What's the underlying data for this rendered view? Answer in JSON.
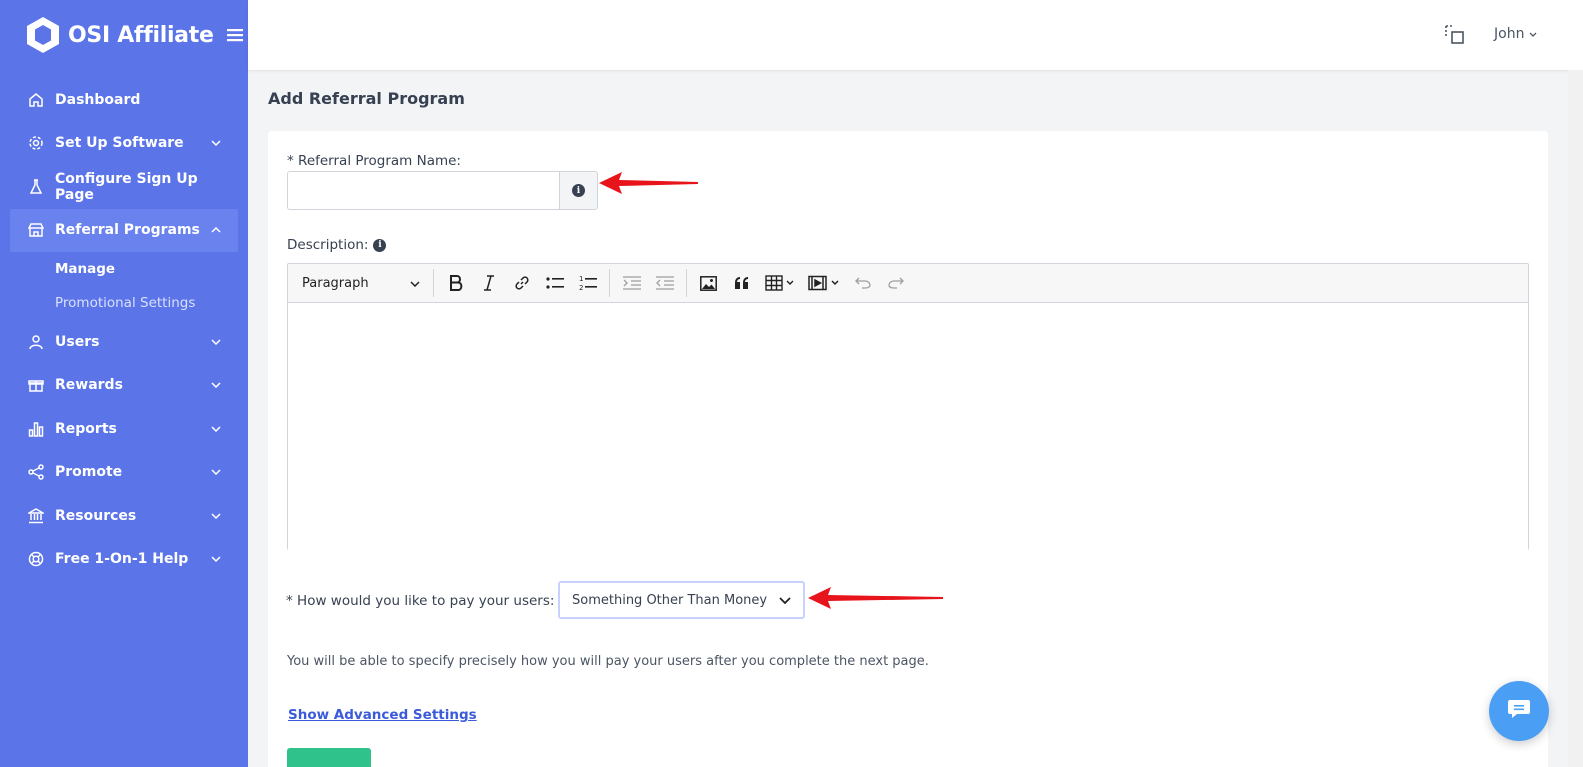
{
  "brand": {
    "name": "OSI Affiliate"
  },
  "sidebar": {
    "items": [
      {
        "label": "Dashboard",
        "icon": "home-icon",
        "has_children": false
      },
      {
        "label": "Set Up Software",
        "icon": "gear-icon",
        "has_children": true
      },
      {
        "label": "Configure Sign Up Page",
        "icon": "flask-icon",
        "has_children": false
      },
      {
        "label": "Referral Programs",
        "icon": "store-icon",
        "has_children": true,
        "expanded": true,
        "children": [
          {
            "label": "Manage",
            "current": true
          },
          {
            "label": "Promotional Settings"
          }
        ]
      },
      {
        "label": "Users",
        "icon": "user-icon",
        "has_children": true
      },
      {
        "label": "Rewards",
        "icon": "gift-icon",
        "has_children": true
      },
      {
        "label": "Reports",
        "icon": "bar-chart-icon",
        "has_children": true
      },
      {
        "label": "Promote",
        "icon": "share-icon",
        "has_children": true
      },
      {
        "label": "Resources",
        "icon": "bank-icon",
        "has_children": true
      },
      {
        "label": "Free 1-On-1 Help",
        "icon": "lifebuoy-icon",
        "has_children": true
      }
    ]
  },
  "topbar": {
    "user_name": "John"
  },
  "page": {
    "title": "Add Referral Program",
    "name_field": {
      "label": "* Referral Program Name:",
      "value": "",
      "placeholder": ""
    },
    "description": {
      "label": "Description:",
      "toolbar_heading": "Paragraph"
    },
    "pay": {
      "label": "* How would you like to pay your users:",
      "selected": "Something Other Than Money"
    },
    "help_text": "You will be able to specify precisely how you will pay your users after you complete the next page.",
    "advanced_link": "Show Advanced Settings"
  },
  "colors": {
    "sidebar": "#5b74e8",
    "active_item": "#6a82ee",
    "accent_link": "#3b5bdb",
    "submit": "#2fc28a",
    "arrow": "#e8141c",
    "chat": "#4a9ff5"
  }
}
